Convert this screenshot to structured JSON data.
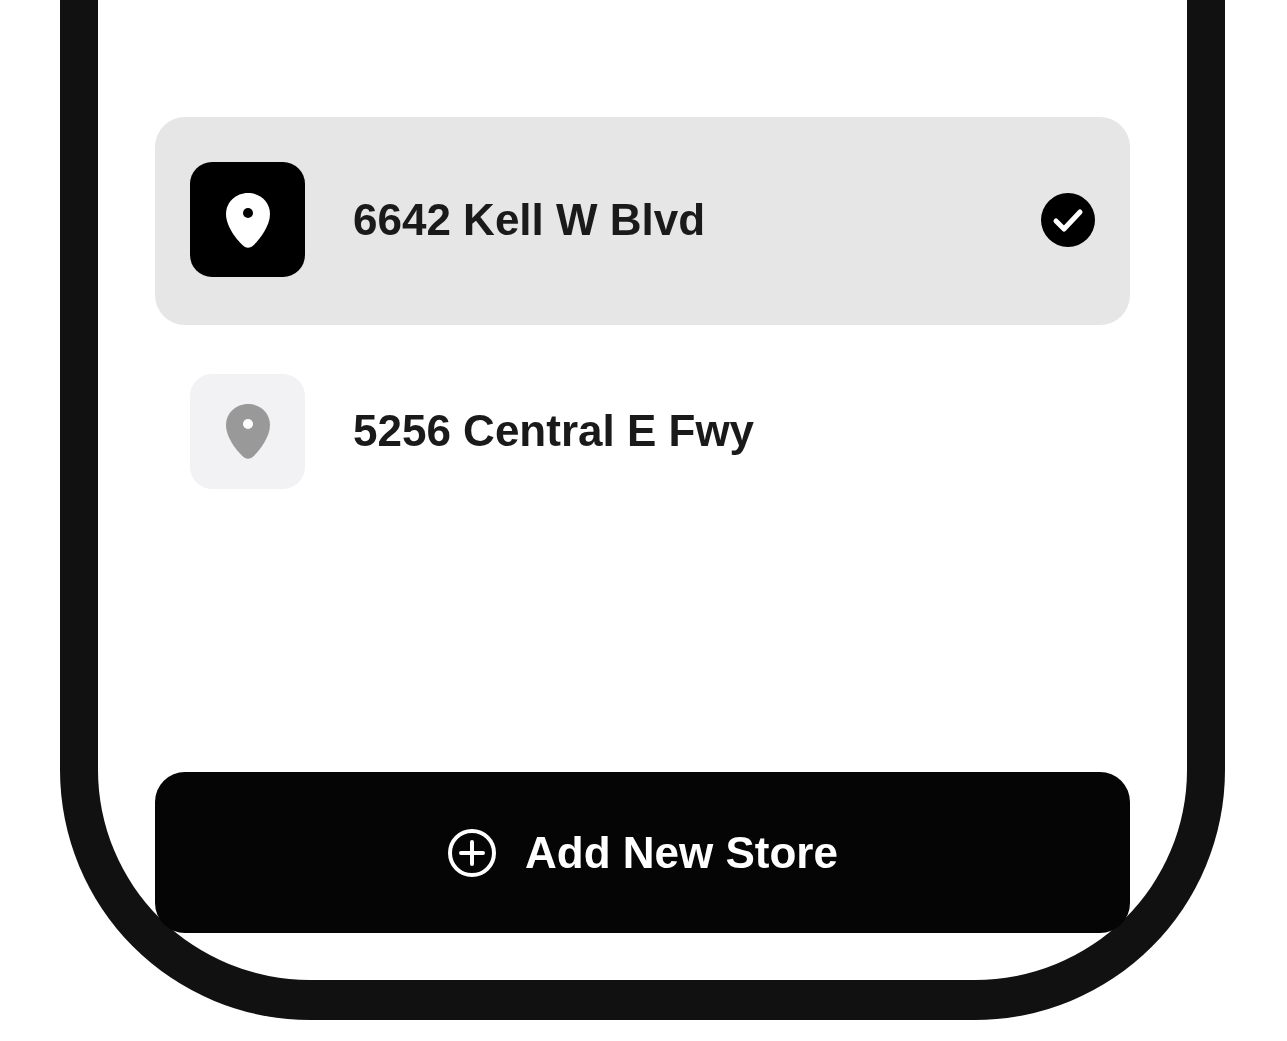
{
  "stores": [
    {
      "label": "6642 Kell W Blvd",
      "selected": true
    },
    {
      "label": "5256 Central E Fwy",
      "selected": false
    }
  ],
  "add_button": {
    "label": "Add New Store"
  }
}
